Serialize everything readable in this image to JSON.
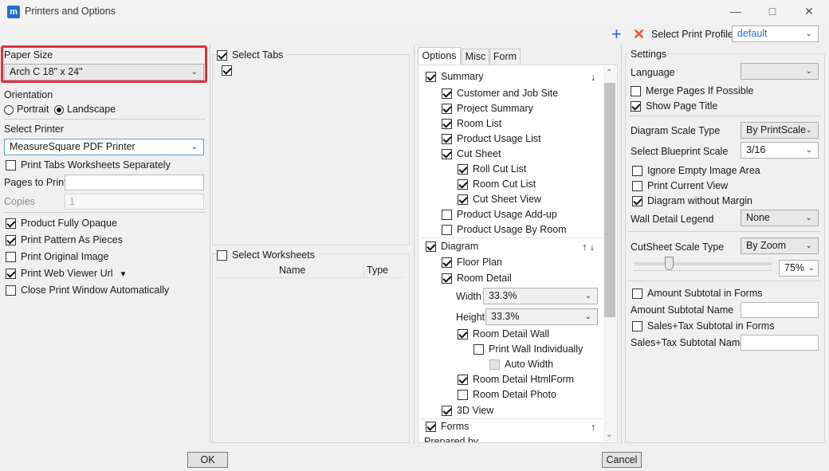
{
  "window": {
    "title": "Printers and Options",
    "icon": "m"
  },
  "toolbar": {
    "select_print_profile_label": "Select Print Profile",
    "profile_value": "default"
  },
  "left": {
    "paper_size_label": "Paper Size",
    "paper_size_value": "Arch C 18\" x 24\"",
    "orientation_label": "Orientation",
    "portrait_label": "Portrait",
    "landscape_label": "Landscape",
    "select_printer_label": "Select Printer",
    "printer_value": "MeasureSquare PDF Printer",
    "print_tabs_separately_label": "Print Tabs Worksheets Separately",
    "pages_to_print_label": "Pages to Print",
    "pages_to_print_value": "",
    "copies_label": "Copies",
    "copies_value": "1",
    "options": [
      {
        "label": "Product Fully Opaque",
        "checked": true
      },
      {
        "label": "Print Pattern As Pieces",
        "checked": true
      },
      {
        "label": "Print Original Image",
        "checked": false
      },
      {
        "label": "Print Web Viewer Url",
        "checked": true
      },
      {
        "label": "Close Print Window Automatically",
        "checked": false
      }
    ]
  },
  "middle": {
    "select_tabs_label": "Select Tabs",
    "select_worksheets_label": "Select Worksheets",
    "worksheet_columns": [
      "Name",
      "Type"
    ]
  },
  "options_panel": {
    "tabs": [
      "Options",
      "Misc",
      "Form"
    ],
    "summary_label": "Summary",
    "summary_items": [
      "Customer and Job Site",
      "Project Summary",
      "Room List",
      "Product Usage List",
      "Cut Sheet"
    ],
    "cut_sheet_items": [
      "Roll Cut List",
      "Room Cut List",
      "Cut Sheet View"
    ],
    "product_usage_addup": "Product Usage Add-up",
    "product_usage_by_room": "Product Usage By Room",
    "diagram_label": "Diagram",
    "floor_plan": "Floor Plan",
    "room_detail": "Room Detail",
    "width_label": "Width",
    "width_value": "33.3%",
    "height_label": "Height",
    "height_value": "33.3%",
    "room_detail_wall": "Room Detail Wall",
    "print_wall_individually": "Print Wall Individually",
    "auto_width": "Auto Width",
    "room_detail_htmlform": "Room Detail HtmlForm",
    "room_detail_photo": "Room Detail Photo",
    "view_3d": "3D View",
    "forms_label": "Forms",
    "prepared_by": "Prepared by",
    "arrow_down": "↓",
    "arrow_up": "↑",
    "arrow_updown": "↑ ↓"
  },
  "settings": {
    "title": "Settings",
    "language_label": "Language",
    "language_value": "",
    "merge_pages": "Merge Pages If Possible",
    "show_page_title": "Show Page Title",
    "diagram_scale_type_label": "Diagram Scale Type",
    "diagram_scale_type_value": "By PrintScale",
    "blueprint_scale_label": "Select Blueprint Scale",
    "blueprint_scale_value": "3/16",
    "ignore_empty": "Ignore Empty Image Area",
    "print_current_view": "Print Current View",
    "diagram_without_margin": "Diagram without Margin",
    "wall_detail_legend_label": "Wall Detail Legend",
    "wall_detail_legend_value": "None",
    "cutsheet_scale_type_label": "CutSheet Scale Type",
    "cutsheet_scale_type_value": "By Zoom",
    "zoom_value": "75%",
    "zoom_fraction": 0.25,
    "amount_subtotal_forms": "Amount Subtotal in Forms",
    "amount_subtotal_name_label": "Amount Subtotal Name",
    "amount_subtotal_name_value": "",
    "sales_tax_subtotal_forms": "Sales+Tax Subtotal in Forms",
    "sales_tax_subtotal_name_label": "Sales+Tax Subtotal Name",
    "sales_tax_subtotal_name_value": ""
  },
  "footer": {
    "ok_label": "OK",
    "cancel_label": "Cancel"
  },
  "colors": {
    "accent": "#1f6fd1",
    "highlight_border": "#e0303a",
    "close_x": "#e05a2b"
  }
}
